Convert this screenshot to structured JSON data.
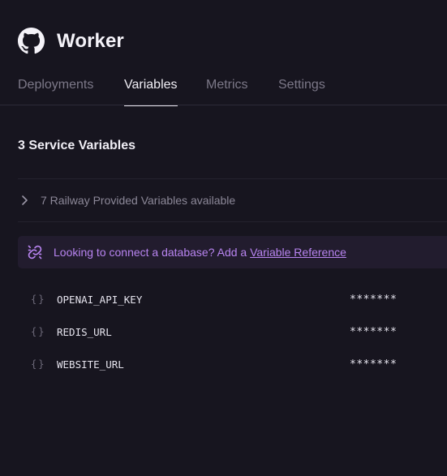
{
  "service": {
    "title": "Worker",
    "icon": "github-icon"
  },
  "tabs": [
    {
      "label": "Deployments",
      "active": false
    },
    {
      "label": "Variables",
      "active": true
    },
    {
      "label": "Metrics",
      "active": false
    },
    {
      "label": "Settings",
      "active": false
    }
  ],
  "variables_section": {
    "title": "3 Service Variables",
    "provided_text": "7 Railway Provided Variables available",
    "banner": {
      "text": "Looking to connect a database? Add a ",
      "link_label": "Variable Reference",
      "icon": "link-icon"
    },
    "variables": [
      {
        "braces": "{}",
        "name": "OPENAI_API_KEY",
        "value": "*******"
      },
      {
        "braces": "{}",
        "name": "REDIS_URL",
        "value": "*******"
      },
      {
        "braces": "{}",
        "name": "WEBSITE_URL",
        "value": "*******"
      }
    ]
  },
  "colors": {
    "background": "#17151f",
    "accent": "#b884f0",
    "banner_bg": "#221c2e",
    "muted_text": "#8c8898"
  }
}
